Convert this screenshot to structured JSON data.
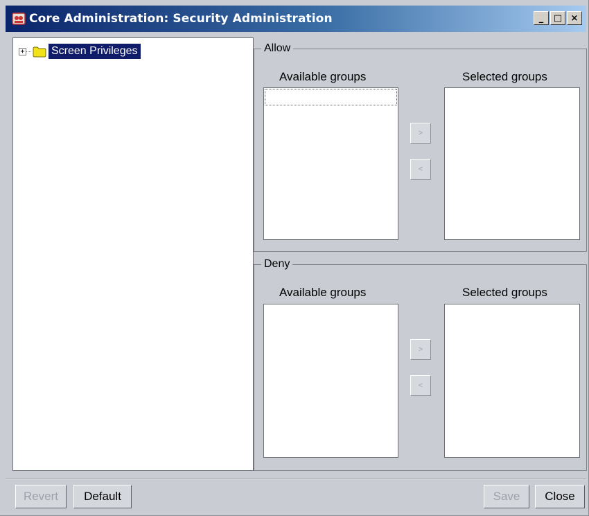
{
  "window": {
    "title": "Core Administration: Security Administration",
    "controls": {
      "minimize": "_",
      "maximize": "□",
      "close": "×"
    }
  },
  "tree": {
    "nodes": [
      {
        "label": "Screen Privileges",
        "expander": "+",
        "icon": "folder-icon",
        "selected": true
      }
    ]
  },
  "allow": {
    "legend": "Allow",
    "available_title": "Available groups",
    "selected_title": "Selected groups",
    "add_label": ">",
    "remove_label": "<"
  },
  "deny": {
    "legend": "Deny",
    "available_title": "Available groups",
    "selected_title": "Selected groups",
    "add_label": ">",
    "remove_label": "<"
  },
  "buttons": {
    "revert": "Revert",
    "default": "Default",
    "save": "Save",
    "close": "Close"
  },
  "colors": {
    "title_gradient_start": "#0a246a",
    "title_gradient_end": "#a6caf0",
    "selection": "#0f1c6a",
    "panel_bg": "#c9cdd3"
  }
}
